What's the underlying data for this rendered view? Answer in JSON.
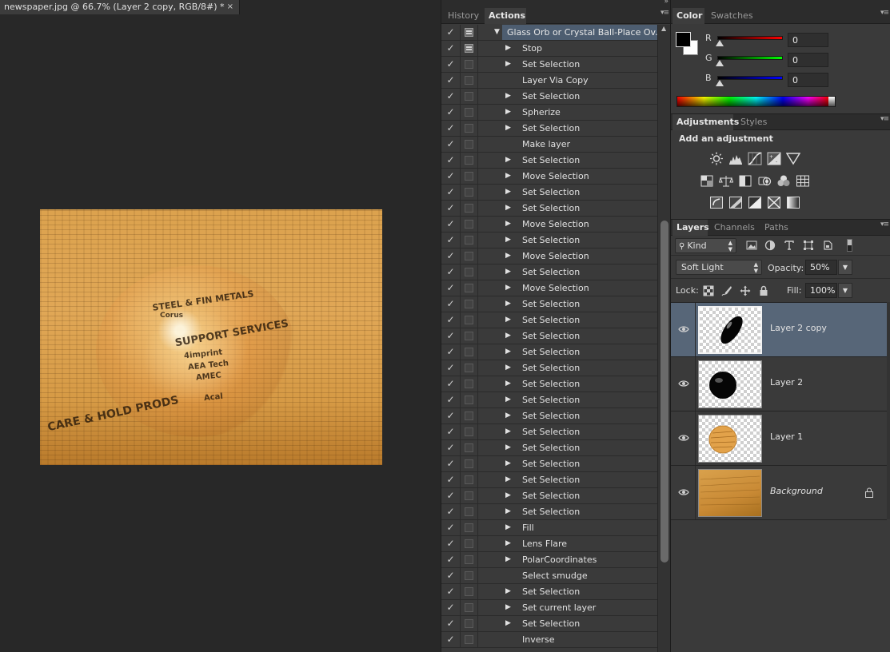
{
  "document": {
    "tab_title": "newspaper.jpg @ 66.7% (Layer 2 copy, RGB/8#) *",
    "close_glyph": "×",
    "image_text": {
      "heading1": "STEEL & FIN METALS",
      "heading2": "SUPPORT SERVICES",
      "heading3": "CARE & HOLD PRODS",
      "line1": "Corus",
      "line2": "4imprint",
      "line3": "AEA Tech",
      "line4": "AMEC",
      "line5": "Acal"
    }
  },
  "actions_panel": {
    "tabs": [
      {
        "label": "History",
        "active": false
      },
      {
        "label": "Actions",
        "active": true
      }
    ],
    "set_name": "Glass Orb or Crystal Ball-Place Ov...",
    "check_glyph": "✓",
    "expanded_glyph": "▼",
    "collapsed_glyph": "▶",
    "items": [
      {
        "label": "Stop",
        "expandable": true,
        "dialog": true
      },
      {
        "label": "Set Selection",
        "expandable": true,
        "dialog": false
      },
      {
        "label": "Layer Via Copy",
        "expandable": false,
        "dialog": false
      },
      {
        "label": "Set Selection",
        "expandable": true,
        "dialog": false
      },
      {
        "label": "Spherize",
        "expandable": true,
        "dialog": false
      },
      {
        "label": "Set Selection",
        "expandable": true,
        "dialog": false
      },
      {
        "label": "Make layer",
        "expandable": false,
        "dialog": false
      },
      {
        "label": "Set Selection",
        "expandable": true,
        "dialog": false
      },
      {
        "label": "Move Selection",
        "expandable": true,
        "dialog": false
      },
      {
        "label": "Set Selection",
        "expandable": true,
        "dialog": false
      },
      {
        "label": "Set Selection",
        "expandable": true,
        "dialog": false
      },
      {
        "label": "Move Selection",
        "expandable": true,
        "dialog": false
      },
      {
        "label": "Set Selection",
        "expandable": true,
        "dialog": false
      },
      {
        "label": "Move Selection",
        "expandable": true,
        "dialog": false
      },
      {
        "label": "Set Selection",
        "expandable": true,
        "dialog": false
      },
      {
        "label": "Move Selection",
        "expandable": true,
        "dialog": false
      },
      {
        "label": "Set Selection",
        "expandable": true,
        "dialog": false
      },
      {
        "label": "Set Selection",
        "expandable": true,
        "dialog": false
      },
      {
        "label": "Set Selection",
        "expandable": true,
        "dialog": false
      },
      {
        "label": "Set Selection",
        "expandable": true,
        "dialog": false
      },
      {
        "label": "Set Selection",
        "expandable": true,
        "dialog": false
      },
      {
        "label": "Set Selection",
        "expandable": true,
        "dialog": false
      },
      {
        "label": "Set Selection",
        "expandable": true,
        "dialog": false
      },
      {
        "label": "Set Selection",
        "expandable": true,
        "dialog": false
      },
      {
        "label": "Set Selection",
        "expandable": true,
        "dialog": false
      },
      {
        "label": "Set Selection",
        "expandable": true,
        "dialog": false
      },
      {
        "label": "Set Selection",
        "expandable": true,
        "dialog": false
      },
      {
        "label": "Set Selection",
        "expandable": true,
        "dialog": false
      },
      {
        "label": "Set Selection",
        "expandable": true,
        "dialog": false
      },
      {
        "label": "Set Selection",
        "expandable": true,
        "dialog": false
      },
      {
        "label": "Fill",
        "expandable": true,
        "dialog": false
      },
      {
        "label": "Lens Flare",
        "expandable": true,
        "dialog": false
      },
      {
        "label": "PolarCoordinates",
        "expandable": true,
        "dialog": false
      },
      {
        "label": "Select smudge",
        "expandable": false,
        "dialog": false
      },
      {
        "label": "Set Selection",
        "expandable": true,
        "dialog": false
      },
      {
        "label": "Set current layer",
        "expandable": true,
        "dialog": false
      },
      {
        "label": "Set Selection",
        "expandable": true,
        "dialog": false
      },
      {
        "label": "Inverse",
        "expandable": false,
        "dialog": false
      }
    ]
  },
  "color_panel": {
    "tabs": [
      {
        "label": "Color",
        "active": true
      },
      {
        "label": "Swatches",
        "active": false
      }
    ],
    "foreground": "#000000",
    "background": "#ffffff",
    "channels": [
      {
        "label": "R",
        "value": "0",
        "color": "#ff0000"
      },
      {
        "label": "G",
        "value": "0",
        "color": "#00ff00"
      },
      {
        "label": "B",
        "value": "0",
        "color": "#0000ff"
      }
    ]
  },
  "adjustments_panel": {
    "tabs": [
      {
        "label": "Adjustments",
        "active": true
      },
      {
        "label": "Styles",
        "active": false
      }
    ],
    "title": "Add an adjustment"
  },
  "layers_panel": {
    "tabs": [
      {
        "label": "Layers",
        "active": true
      },
      {
        "label": "Channels",
        "active": false
      },
      {
        "label": "Paths",
        "active": false
      }
    ],
    "kind_filter": "Kind",
    "blend_mode": "Soft Light",
    "opacity_label": "Opacity:",
    "opacity_value": "50%",
    "lock_label": "Lock:",
    "fill_label": "Fill:",
    "fill_value": "100%",
    "layers": [
      {
        "name": "Layer 2 copy",
        "selected": true,
        "italic": false,
        "locked": false
      },
      {
        "name": "Layer 2",
        "selected": false,
        "italic": false,
        "locked": false
      },
      {
        "name": "Layer 1",
        "selected": false,
        "italic": false,
        "locked": false
      },
      {
        "name": "Background",
        "selected": false,
        "italic": true,
        "locked": true
      }
    ]
  },
  "colors": {
    "selection_highlight": "#576678",
    "panel_bg": "#3a3a3a",
    "canvas_bg": "#282828"
  }
}
